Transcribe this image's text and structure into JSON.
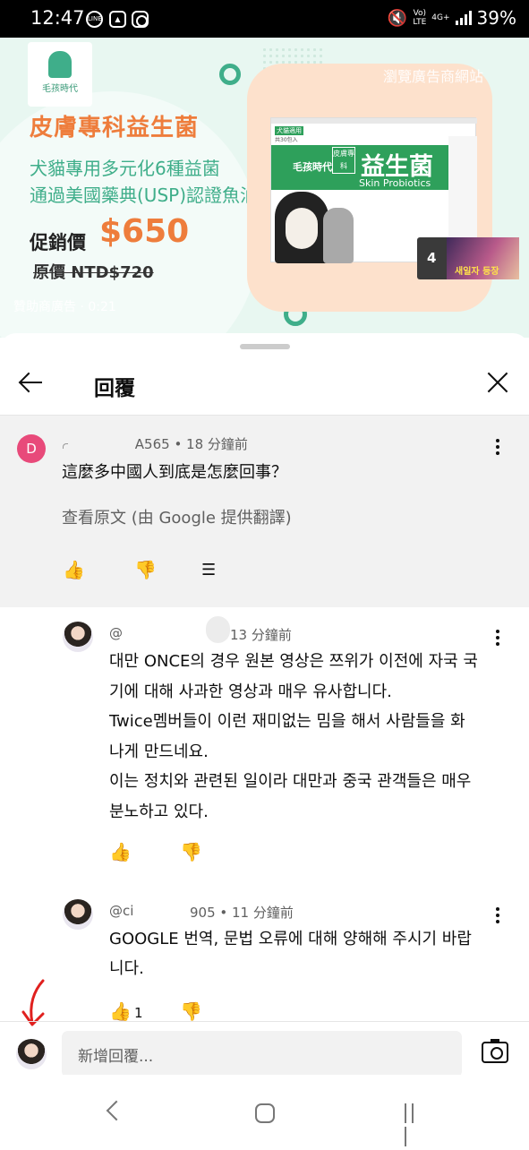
{
  "status_bar": {
    "time": "12:47",
    "app_icons": [
      "line-icon",
      "gallery-icon",
      "instagram-icon"
    ],
    "line_label": "LINE",
    "network_top": "Vo)",
    "network_bottom": "LTE",
    "network_type": "4G+",
    "battery": "39%"
  },
  "ad": {
    "brand": "毛孩時代",
    "headline": "皮膚專科益生菌",
    "line1": "犬貓專用多元化6種益菌",
    "line2": "通過美國藥典(USP)認證魚油",
    "price_label": "促銷價",
    "price": "$650",
    "original_price": "原價 NTD$720",
    "overlay_label": "瀏覽廣告商網站",
    "sponsored": "贊助商廣告 · 0:21",
    "box_tag": "犬貓適用",
    "box_count": "共30包入",
    "box_label": "皮膚專科",
    "product_name": "益生菌",
    "product_sub": "Skin Probiotics",
    "pip_count": "4",
    "pip_caption": "새일자 등장",
    "accent": "#ee7d3c",
    "brand_green": "#3fae8a"
  },
  "sheet": {
    "title": "回覆",
    "back_icon": "arrow-left-icon",
    "close_icon": "close-icon"
  },
  "parent_comment": {
    "avatar_letter": "D",
    "avatar_color": "#e84a7a",
    "meta": "A565 • 18 分鐘前",
    "text": "這麼多中國人到底是怎麼回事？",
    "translate_link": "查看原文 (由 Google 提供翻譯)"
  },
  "replies": [
    {
      "handle": "@",
      "time": "13 分鐘前",
      "lines": [
        "대만 ONCE의 경우 원본 영상은 쯔위가 이전에 자국 국",
        "기에 대해 사과한 영상과 매우 유사합니다.",
        "Twice멤버들이 이런 재미없는 밈을 해서 사람들을 화",
        "나게 만드네요.",
        "이는 정치와 관련된 일이라 대만과 중국 관객들은 매우",
        "분노하고 있다."
      ]
    },
    {
      "handle": "@ci",
      "time": "905 • 11 分鐘前",
      "lines": [
        "GOOGLE 번역, 문법 오류에 대해 양해해 주시기 바랍",
        "니다."
      ],
      "likes": "1"
    }
  ],
  "reply_box": {
    "placeholder": "新增回覆..."
  }
}
